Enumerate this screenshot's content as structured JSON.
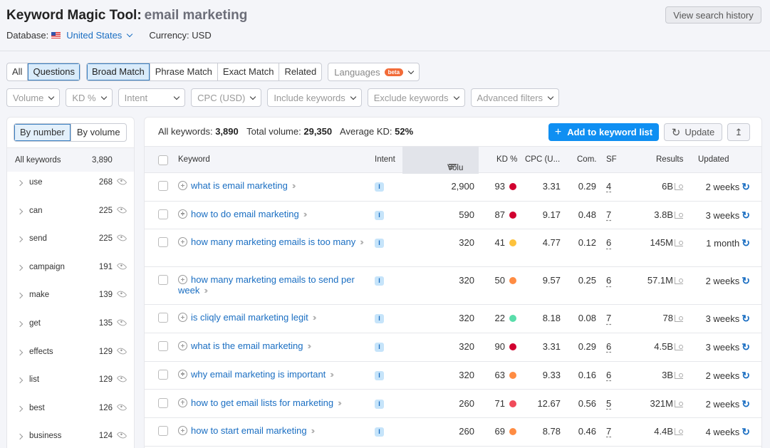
{
  "header": {
    "title": "Keyword Magic Tool:",
    "query": "email marketing",
    "database_label": "Database:",
    "database_value": "United States",
    "currency": "Currency: USD",
    "history_button": "View search history"
  },
  "match_tabs": {
    "group1": [
      {
        "label": "All",
        "active": false
      },
      {
        "label": "Questions",
        "active": true
      }
    ],
    "group2": [
      {
        "label": "Broad Match",
        "active": true
      },
      {
        "label": "Phrase Match",
        "active": false
      },
      {
        "label": "Exact Match",
        "active": false
      },
      {
        "label": "Related",
        "active": false
      }
    ],
    "languages": {
      "label": "Languages",
      "badge": "beta"
    }
  },
  "filters": [
    "Volume",
    "KD %",
    "Intent",
    "CPC (USD)",
    "Include keywords",
    "Exclude keywords",
    "Advanced filters"
  ],
  "sidebar": {
    "toggle": [
      {
        "label": "By number",
        "active": true
      },
      {
        "label": "By volume",
        "active": false
      }
    ],
    "all_label": "All keywords",
    "all_count": "3,890",
    "items": [
      {
        "label": "use",
        "count": "268"
      },
      {
        "label": "can",
        "count": "225"
      },
      {
        "label": "send",
        "count": "225"
      },
      {
        "label": "campaign",
        "count": "191"
      },
      {
        "label": "make",
        "count": "139"
      },
      {
        "label": "get",
        "count": "135"
      },
      {
        "label": "effects",
        "count": "129"
      },
      {
        "label": "list",
        "count": "129"
      },
      {
        "label": "best",
        "count": "126"
      },
      {
        "label": "business",
        "count": "124"
      }
    ]
  },
  "summary": {
    "all_keywords_label": "All keywords:",
    "all_keywords": "3,890",
    "total_volume_label": "Total volume:",
    "total_volume": "29,350",
    "avg_kd_label": "Average KD:",
    "avg_kd": "52%"
  },
  "actions": {
    "add": "Add to keyword list",
    "update": "Update"
  },
  "colors": {
    "accent": "#0f8ff2",
    "link": "#1a6ec2",
    "kd_very_hard": "#d1002f",
    "kd_hard": "#f04b5a",
    "kd_difficult": "#ff8c43",
    "kd_possible": "#fdc23c",
    "kd_easy": "#59ddaa"
  },
  "table": {
    "columns": [
      "Keyword",
      "Intent",
      "Volu",
      "KD %",
      "CPC (U...",
      "Com.",
      "SF",
      "Results",
      "Updated"
    ],
    "rows": [
      {
        "keyword": "what is email marketing",
        "intent": "I",
        "volume": "2,900",
        "kd": "93",
        "kd_color": "#d1002f",
        "cpc": "3.31",
        "com": "0.29",
        "sf": "4",
        "results": "6B",
        "updated": "2 weeks"
      },
      {
        "keyword": "how to do email marketing",
        "intent": "I",
        "volume": "590",
        "kd": "87",
        "kd_color": "#d1002f",
        "cpc": "9.17",
        "com": "0.48",
        "sf": "7",
        "results": "3.8B",
        "updated": "3 weeks"
      },
      {
        "keyword": "how many marketing emails is too many",
        "intent": "I",
        "volume": "320",
        "kd": "41",
        "kd_color": "#fdc23c",
        "cpc": "4.77",
        "com": "0.12",
        "sf": "6",
        "results": "145M",
        "updated": "1 month"
      },
      {
        "keyword": "how many marketing emails to send per week",
        "intent": "I",
        "volume": "320",
        "kd": "50",
        "kd_color": "#ff8c43",
        "cpc": "9.57",
        "com": "0.25",
        "sf": "6",
        "results": "57.1M",
        "updated": "2 weeks"
      },
      {
        "keyword": "is cliqly email marketing legit",
        "intent": "I",
        "volume": "320",
        "kd": "22",
        "kd_color": "#59ddaa",
        "cpc": "8.18",
        "com": "0.08",
        "sf": "7",
        "results": "78",
        "updated": "3 weeks"
      },
      {
        "keyword": "what is the email marketing",
        "intent": "I",
        "volume": "320",
        "kd": "90",
        "kd_color": "#d1002f",
        "cpc": "3.31",
        "com": "0.29",
        "sf": "6",
        "results": "4.5B",
        "updated": "3 weeks"
      },
      {
        "keyword": "why email marketing is important",
        "intent": "I",
        "volume": "320",
        "kd": "63",
        "kd_color": "#ff8c43",
        "cpc": "9.33",
        "com": "0.16",
        "sf": "6",
        "results": "3B",
        "updated": "2 weeks"
      },
      {
        "keyword": "how to get email lists for marketing",
        "intent": "I",
        "volume": "260",
        "kd": "71",
        "kd_color": "#f04b5a",
        "cpc": "12.67",
        "com": "0.56",
        "sf": "5",
        "results": "321M",
        "updated": "2 weeks"
      },
      {
        "keyword": "how to start email marketing",
        "intent": "I",
        "volume": "260",
        "kd": "69",
        "kd_color": "#ff8c43",
        "cpc": "8.78",
        "com": "0.46",
        "sf": "7",
        "results": "4.4B",
        "updated": "4 weeks"
      }
    ]
  }
}
